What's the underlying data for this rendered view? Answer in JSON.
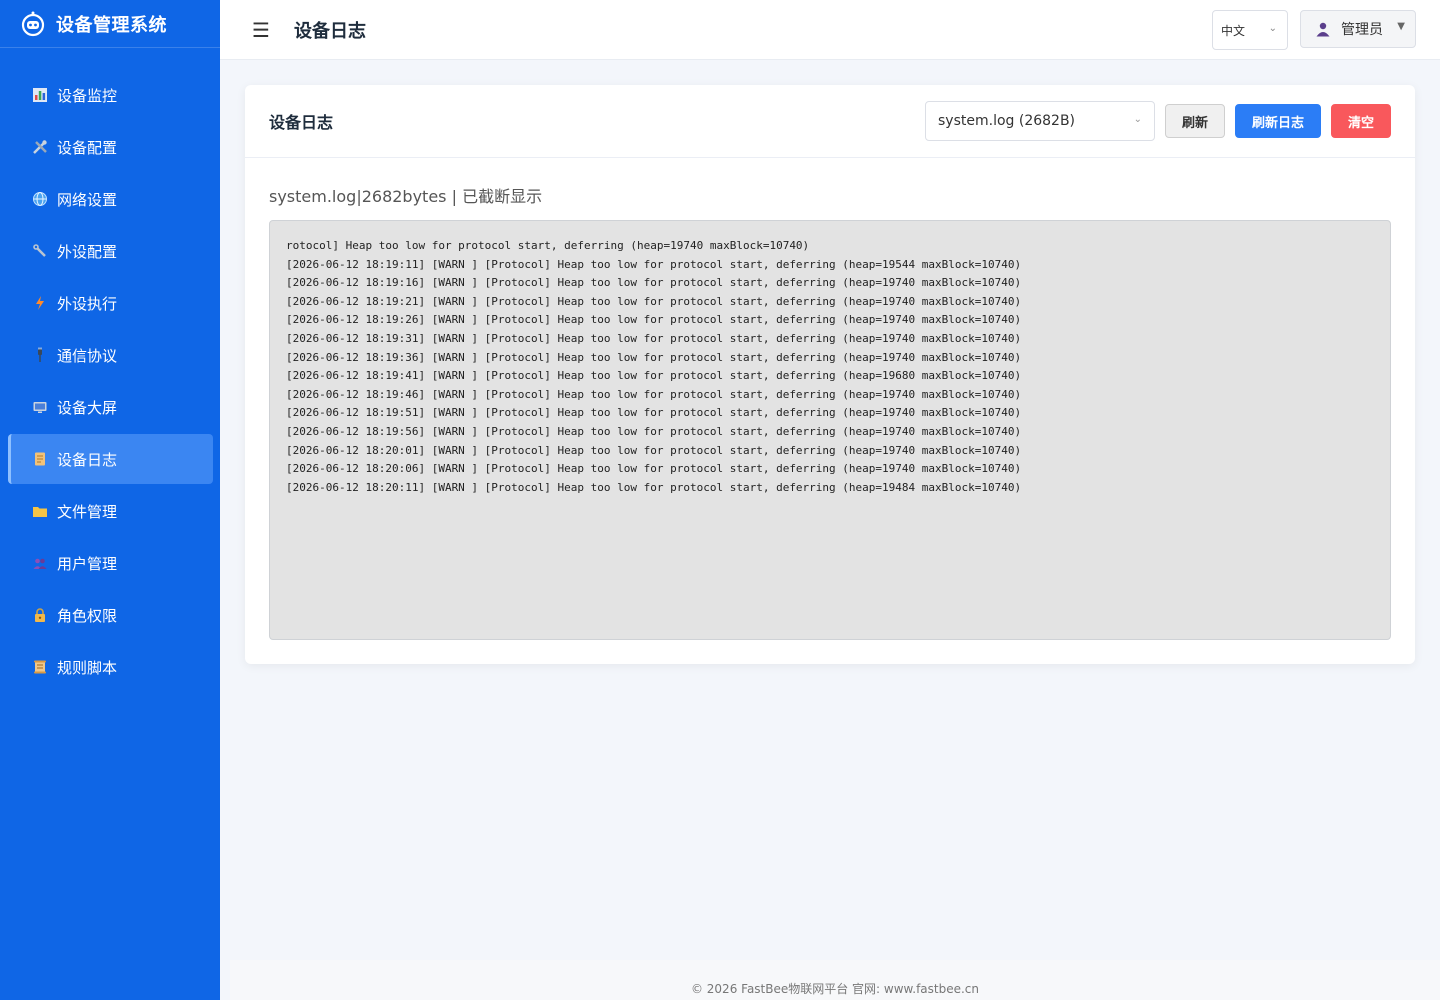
{
  "app": {
    "title": "设备管理系统"
  },
  "sidebar": {
    "items": [
      {
        "label": "设备监控",
        "icon": "bar-chart-icon"
      },
      {
        "label": "设备配置",
        "icon": "tools-icon"
      },
      {
        "label": "网络设置",
        "icon": "globe-icon"
      },
      {
        "label": "外设配置",
        "icon": "wrench-icon"
      },
      {
        "label": "外设执行",
        "icon": "lightning-icon"
      },
      {
        "label": "通信协议",
        "icon": "plug-icon"
      },
      {
        "label": "设备大屏",
        "icon": "monitor-icon"
      },
      {
        "label": "设备日志",
        "icon": "document-icon",
        "active": true
      },
      {
        "label": "文件管理",
        "icon": "folder-icon"
      },
      {
        "label": "用户管理",
        "icon": "users-icon"
      },
      {
        "label": "角色权限",
        "icon": "lock-icon"
      },
      {
        "label": "规则脚本",
        "icon": "scroll-icon"
      }
    ]
  },
  "header": {
    "title": "设备日志",
    "language": "中文",
    "user": "管理员"
  },
  "card": {
    "title": "设备日志",
    "file_select_value": "system.log (2682B)",
    "refresh_label": "刷新",
    "reload_label": "刷新日志",
    "clear_label": "清空",
    "info": "system.log|2682bytes | 已截断显示",
    "log_text": "rotocol] Heap too low for protocol start, deferring (heap=19740 maxBlock=10740)\n[2026-06-12 18:19:11] [WARN ] [Protocol] Heap too low for protocol start, deferring (heap=19544 maxBlock=10740)\n[2026-06-12 18:19:16] [WARN ] [Protocol] Heap too low for protocol start, deferring (heap=19740 maxBlock=10740)\n[2026-06-12 18:19:21] [WARN ] [Protocol] Heap too low for protocol start, deferring (heap=19740 maxBlock=10740)\n[2026-06-12 18:19:26] [WARN ] [Protocol] Heap too low for protocol start, deferring (heap=19740 maxBlock=10740)\n[2026-06-12 18:19:31] [WARN ] [Protocol] Heap too low for protocol start, deferring (heap=19740 maxBlock=10740)\n[2026-06-12 18:19:36] [WARN ] [Protocol] Heap too low for protocol start, deferring (heap=19740 maxBlock=10740)\n[2026-06-12 18:19:41] [WARN ] [Protocol] Heap too low for protocol start, deferring (heap=19680 maxBlock=10740)\n[2026-06-12 18:19:46] [WARN ] [Protocol] Heap too low for protocol start, deferring (heap=19740 maxBlock=10740)\n[2026-06-12 18:19:51] [WARN ] [Protocol] Heap too low for protocol start, deferring (heap=19740 maxBlock=10740)\n[2026-06-12 18:19:56] [WARN ] [Protocol] Heap too low for protocol start, deferring (heap=19740 maxBlock=10740)\n[2026-06-12 18:20:01] [WARN ] [Protocol] Heap too low for protocol start, deferring (heap=19740 maxBlock=10740)\n[2026-06-12 18:20:06] [WARN ] [Protocol] Heap too low for protocol start, deferring (heap=19740 maxBlock=10740)\n[2026-06-12 18:20:11] [WARN ] [Protocol] Heap too low for protocol start, deferring (heap=19484 maxBlock=10740)"
  },
  "footer": {
    "text": "© 2026 FastBee物联网平台 官网: www.fastbee.cn"
  },
  "colors": {
    "sidebar_bg": "#0f66e6",
    "active_item_bg": "#3b86f2",
    "primary_button": "#2b7df6",
    "danger_button": "#f9585c"
  }
}
